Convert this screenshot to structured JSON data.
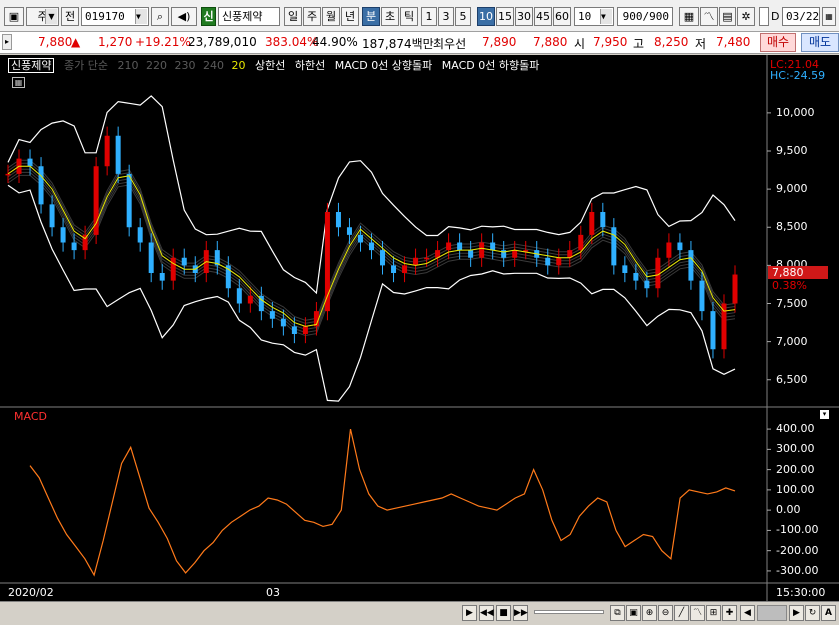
{
  "toolbar": {
    "type1": "주",
    "type2": "전",
    "code": "019170",
    "stock_badge": "신",
    "stock_name": "신풍제약",
    "periods": [
      "일",
      "주",
      "월",
      "년",
      "분",
      "초",
      "틱"
    ],
    "intervals": [
      "1",
      "3",
      "5",
      "10",
      "15",
      "30",
      "45",
      "60"
    ],
    "interval_value": "10",
    "count": "900/900",
    "date_label": "D",
    "date_value": "03/22"
  },
  "quote": {
    "price": "7,880",
    "arrow": "▲",
    "change": "1,270",
    "pct": "+19.21%",
    "volume": "23,789,010",
    "vol_ratio": "383.04%",
    "turnover": "44.90%",
    "amount": "187,874백만",
    "priority_label": "최우선",
    "ask": "7,890",
    "bid": "7,880",
    "open_label": "시",
    "open": "7,950",
    "high_label": "고",
    "high": "8,250",
    "low_label": "저",
    "low": "7,480",
    "buy": "매수",
    "sell": "매도"
  },
  "legend": {
    "name": "신풍제약",
    "ma_label": "종가 단순",
    "ma_periods": [
      "210",
      "220",
      "230",
      "240",
      "20"
    ],
    "upper": "상한선",
    "lower": "하한선",
    "macd_up": "MACD 0선 상향돌파",
    "macd_down": "MACD 0선 하향돌파"
  },
  "price_panel": {
    "lc": "LC:21.04",
    "hc": "HC:-24.59",
    "y_ticks": [
      "10,000",
      "9,500",
      "9,000",
      "8,500",
      "8,000",
      "7,500",
      "7,000",
      "6,500"
    ],
    "current": "7,880",
    "current_pct": "0.38%"
  },
  "macd_panel": {
    "title": "MACD",
    "y_ticks": [
      "400.00",
      "300.00",
      "200.00",
      "100.00",
      "0.00",
      "-100.00",
      "-200.00",
      "-300.00"
    ]
  },
  "x_axis": {
    "labels": [
      "2020/02",
      "03"
    ],
    "time": "15:30:00"
  },
  "colors": {
    "up": "#e00000",
    "down": "#2fb0ff",
    "ma": "#e8e800",
    "band": "#ffffff",
    "macd": "#ff7a1a"
  },
  "chart_data": {
    "type": "line",
    "price": [
      9200,
      9400,
      9300,
      8800,
      8500,
      8300,
      8200,
      8400,
      9300,
      9700,
      9200,
      8500,
      8300,
      7900,
      7800,
      8100,
      8000,
      7900,
      8200,
      8000,
      7700,
      7500,
      7600,
      7400,
      7300,
      7200,
      7100,
      7200,
      7400,
      8700,
      8500,
      8400,
      8300,
      8200,
      8000,
      7900,
      8000,
      8100,
      8100,
      8200,
      8300,
      8200,
      8100,
      8300,
      8200,
      8100,
      8200,
      8200,
      8100,
      8000,
      8100,
      8200,
      8400,
      8700,
      8500,
      8000,
      7900,
      7800,
      7700,
      8100,
      8300,
      8200,
      7800,
      7400,
      6900,
      7500,
      7880
    ],
    "macd": [
      220,
      160,
      60,
      -40,
      -120,
      -180,
      -240,
      -320,
      -150,
      40,
      230,
      310,
      160,
      10,
      -60,
      -140,
      -250,
      -310,
      -260,
      -200,
      -160,
      -100,
      -60,
      -30,
      0,
      20,
      60,
      50,
      30,
      -10,
      -50,
      -60,
      -80,
      -70,
      0,
      400,
      200,
      80,
      20,
      0,
      10,
      20,
      30,
      40,
      50,
      60,
      80,
      60,
      40,
      20,
      10,
      0,
      30,
      60,
      80,
      200,
      100,
      -50,
      -150,
      -120,
      -30,
      20,
      60,
      40,
      -100,
      -180,
      -150,
      -120,
      -130,
      -200,
      -240,
      60,
      100,
      90,
      80,
      90,
      110,
      95
    ],
    "price_ylim": [
      6300,
      10300
    ],
    "macd_ylim": [
      -330,
      440
    ]
  }
}
